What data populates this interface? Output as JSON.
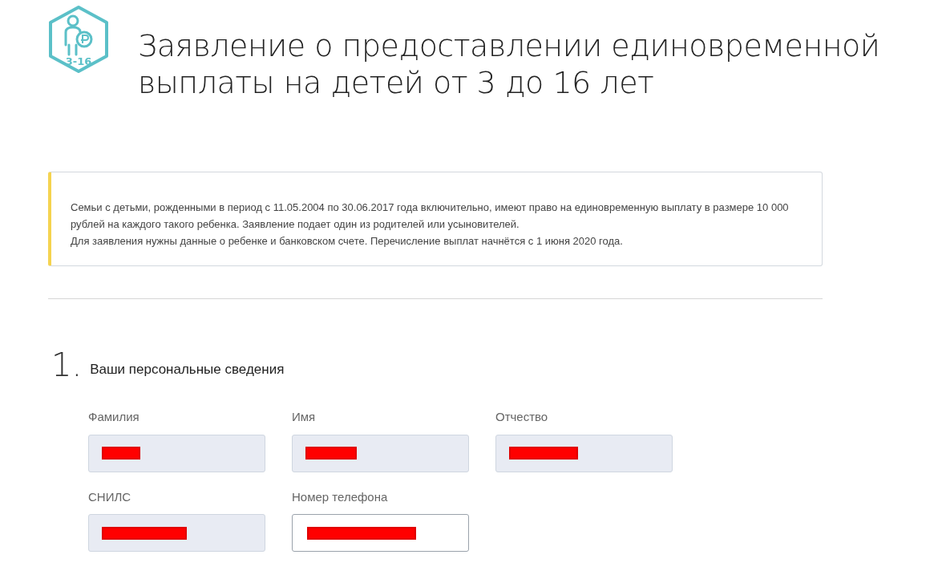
{
  "header": {
    "logo_badge": "3-16",
    "title": "Заявление о предоставлении единовременной выплаты на детей от 3 до 16 лет"
  },
  "notice": {
    "paragraphs": [
      "Семьи с детьми, рожденными в период с 11.05.2004 по 30.06.2017 года включительно, имеют право на единовременную выплату в размере 10 000 рублей на каждого такого ребенка. Заявление подает один из родителей или усыновителей.",
      "Для заявления нужны данные о ребенке и банковском счете. Перечисление выплат начнётся с 1 июня 2020 года."
    ]
  },
  "section": {
    "number": "1.",
    "title": "Ваши персональные сведения",
    "fields": [
      {
        "label": "Фамилия",
        "disabled": true,
        "redacted": true
      },
      {
        "label": "Имя",
        "disabled": true,
        "redacted": true
      },
      {
        "label": "Отчество",
        "disabled": true,
        "redacted": true
      },
      {
        "label": "СНИЛС",
        "disabled": true,
        "redacted": true
      },
      {
        "label": "Номер телефона",
        "disabled": false,
        "redacted": true
      }
    ]
  }
}
